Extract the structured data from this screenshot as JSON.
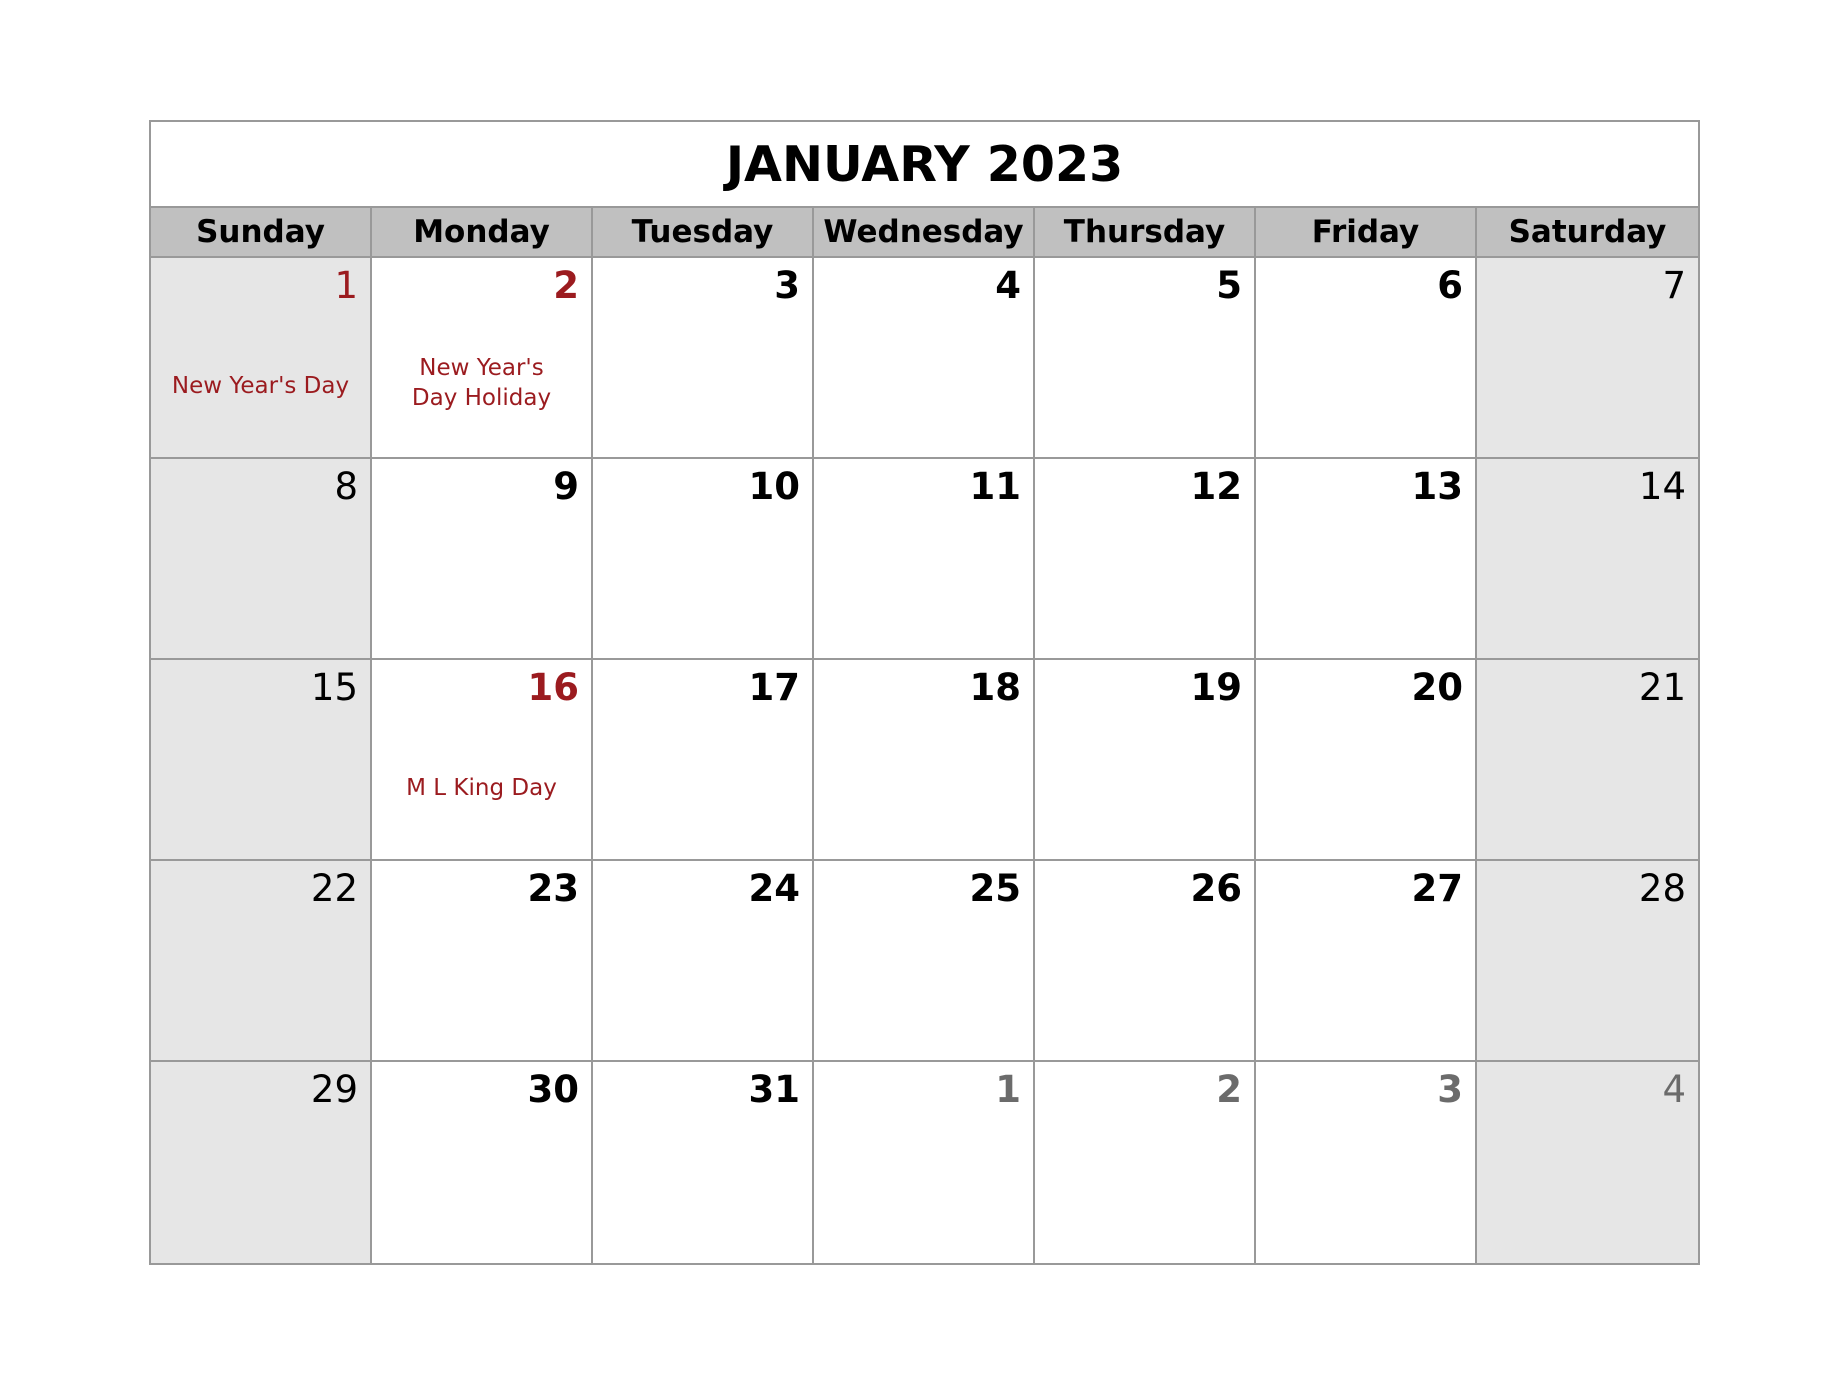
{
  "title": "JANUARY 2023",
  "colors": {
    "holiday": "#9b1b1f",
    "other_month": "#6b6b6b",
    "header_bg": "#c0c0c0",
    "weekend_bg": "#e6e6e6",
    "border": "#999999"
  },
  "weekdays": [
    "Sunday",
    "Monday",
    "Tuesday",
    "Wednesday",
    "Thursday",
    "Friday",
    "Saturday"
  ],
  "weeks": [
    [
      {
        "day": "1",
        "holiday": true,
        "event": "New Year's Day"
      },
      {
        "day": "2",
        "holiday": true,
        "event": "New Year's Day Holiday"
      },
      {
        "day": "3"
      },
      {
        "day": "4"
      },
      {
        "day": "5"
      },
      {
        "day": "6"
      },
      {
        "day": "7"
      }
    ],
    [
      {
        "day": "8"
      },
      {
        "day": "9"
      },
      {
        "day": "10"
      },
      {
        "day": "11"
      },
      {
        "day": "12"
      },
      {
        "day": "13"
      },
      {
        "day": "14"
      }
    ],
    [
      {
        "day": "15"
      },
      {
        "day": "16",
        "holiday": true,
        "event": "M L King Day"
      },
      {
        "day": "17"
      },
      {
        "day": "18"
      },
      {
        "day": "19"
      },
      {
        "day": "20"
      },
      {
        "day": "21"
      }
    ],
    [
      {
        "day": "22"
      },
      {
        "day": "23"
      },
      {
        "day": "24"
      },
      {
        "day": "25"
      },
      {
        "day": "26"
      },
      {
        "day": "27"
      },
      {
        "day": "28"
      }
    ],
    [
      {
        "day": "29"
      },
      {
        "day": "30"
      },
      {
        "day": "31"
      },
      {
        "day": "1",
        "other_month": true
      },
      {
        "day": "2",
        "other_month": true
      },
      {
        "day": "3",
        "other_month": true
      },
      {
        "day": "4",
        "other_month": true
      }
    ]
  ]
}
